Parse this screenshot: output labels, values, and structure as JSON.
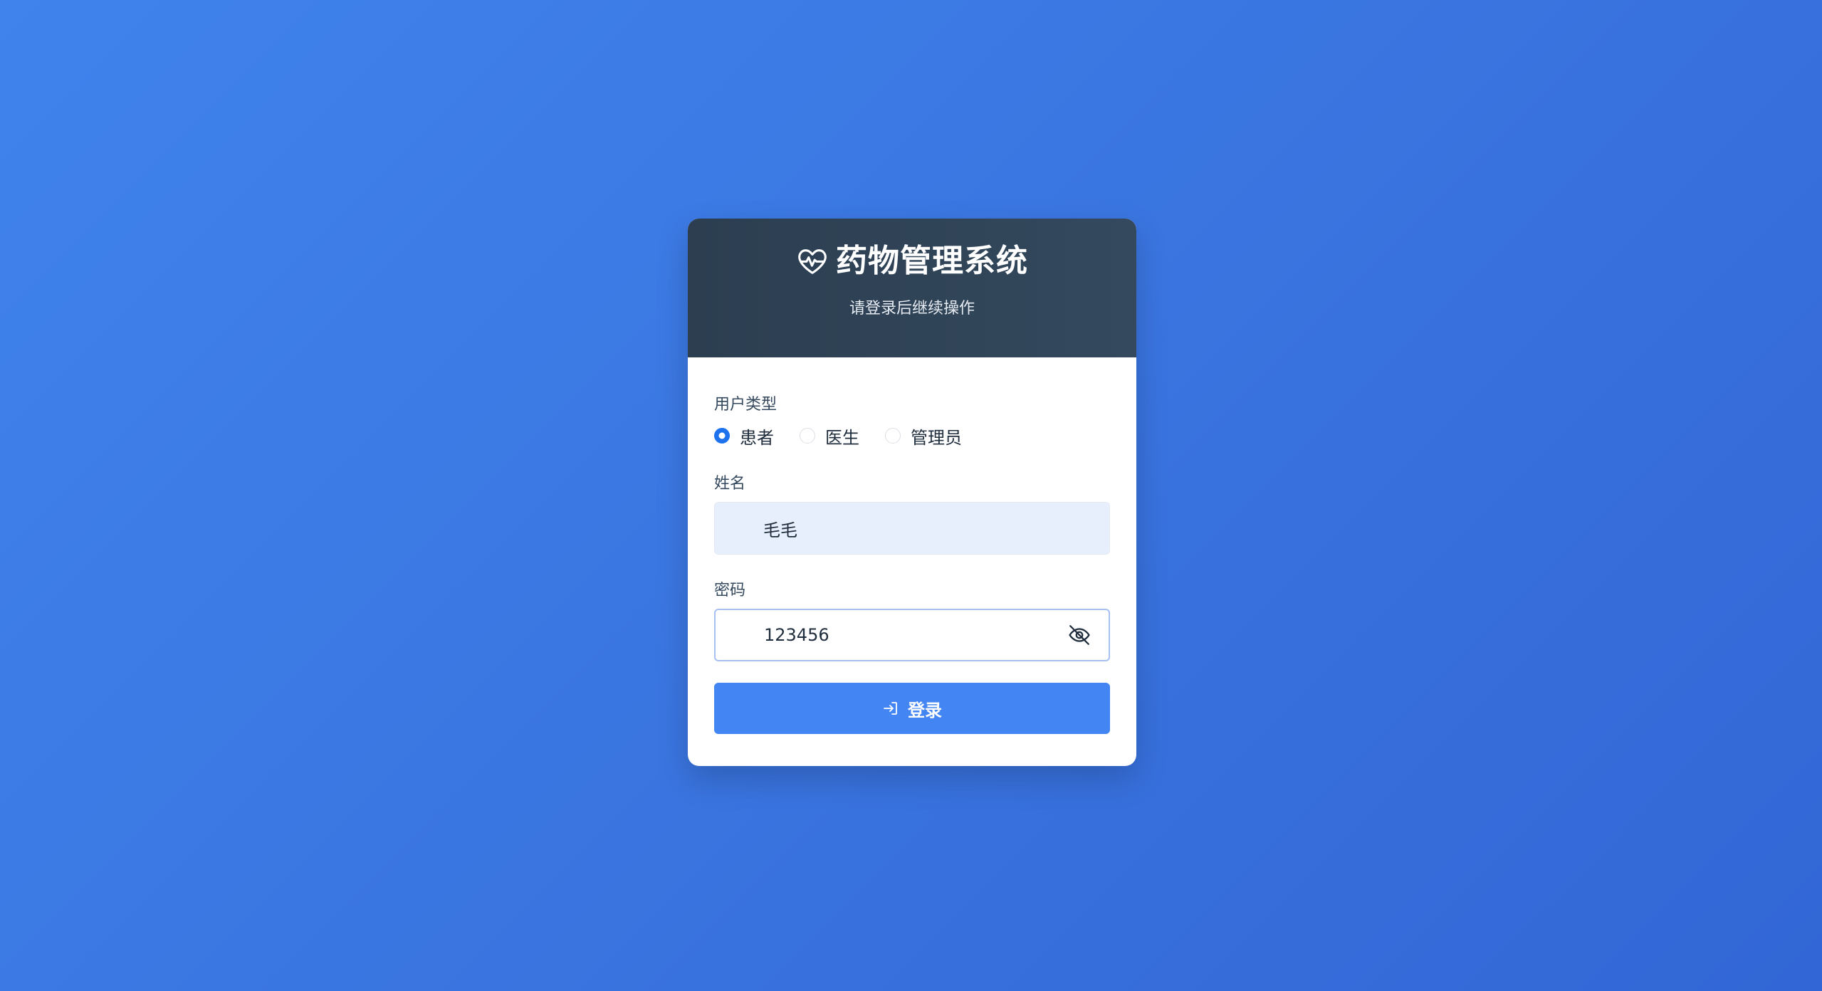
{
  "header": {
    "title": "药物管理系统",
    "subtitle": "请登录后继续操作",
    "icon": "heart-pulse-icon"
  },
  "form": {
    "user_type_label": "用户类型",
    "user_types": [
      {
        "label": "患者",
        "checked": true
      },
      {
        "label": "医生",
        "checked": false
      },
      {
        "label": "管理员",
        "checked": false
      }
    ],
    "name_label": "姓名",
    "name_value": "毛毛",
    "password_label": "密码",
    "password_value": "123456",
    "password_toggle_icon": "eye-off-icon",
    "login_label": "登录",
    "login_icon": "login-icon"
  },
  "colors": {
    "accent": "#4385f2",
    "radio_checked": "#1f72ee",
    "header_bg": "#2c3e50"
  }
}
